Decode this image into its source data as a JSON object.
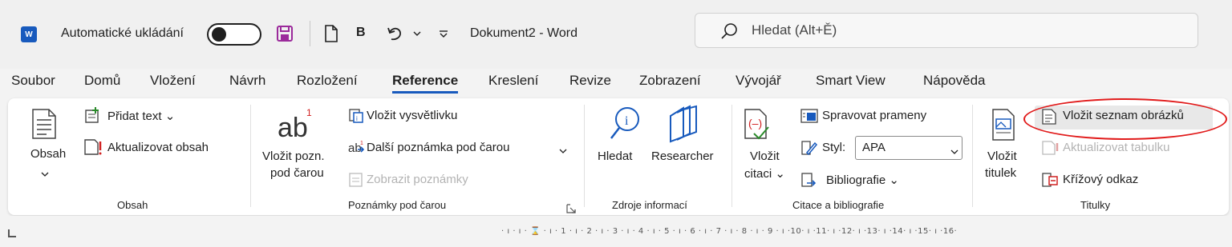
{
  "titlebar": {
    "logo": "W",
    "autosave_label": "Automatické ukládání",
    "bold_label": "B",
    "doc_title": "Dokument2  -  Word",
    "search_placeholder": "Hledat (Alt+Ě)"
  },
  "menu": {
    "tabs": [
      "Soubor",
      "Domů",
      "Vložení",
      "Návrh",
      "Rozložení",
      "Reference",
      "Kreslení",
      "Revize",
      "Zobrazení",
      "Vývojář",
      "Smart View",
      "Nápověda"
    ],
    "active": "Reference"
  },
  "ribbon": {
    "obsah": {
      "button": "Obsah",
      "add_text": "Přidat text",
      "update": "Aktualizovat obsah",
      "group": "Obsah"
    },
    "footnotes": {
      "insert_l1": "Vložit pozn.",
      "insert_l2": "pod čarou",
      "endnote": "Vložit vysvětlivku",
      "next": "Další poznámka pod čarou",
      "show": "Zobrazit poznámky",
      "group": "Poznámky pod čarou"
    },
    "research": {
      "search": "Hledat",
      "researcher": "Researcher",
      "group": "Zdroje informací"
    },
    "citations": {
      "insert_l1": "Vložit",
      "insert_l2": "citaci",
      "manage": "Spravovat prameny",
      "style_label": "Styl:",
      "style_value": "APA",
      "bibliography": "Bibliografie",
      "group": "Citace a bibliografie"
    },
    "captions": {
      "insert_l1": "Vložit",
      "insert_l2": "titulek",
      "table_of_figures": "Vložit seznam obrázků",
      "update_table": "Aktualizovat tabulku",
      "cross_ref": "Křížový odkaz",
      "group": "Titulky"
    }
  },
  "ruler": {
    "text": "· ı · ı · ⌛ · ı · 1 · ı · 2 · ı · 3 · ı · 4 · ı · 5 · ı · 6 · ı · 7 · ı · 8 · ı · 9 · ı ·10· ı ·11· ı ·12· ı ·13· ı ·14· ı ·15· ı ·16·"
  },
  "colors": {
    "accent": "#185abd",
    "highlight": "#e11b1b",
    "save_icon": "#9b2a9b"
  }
}
